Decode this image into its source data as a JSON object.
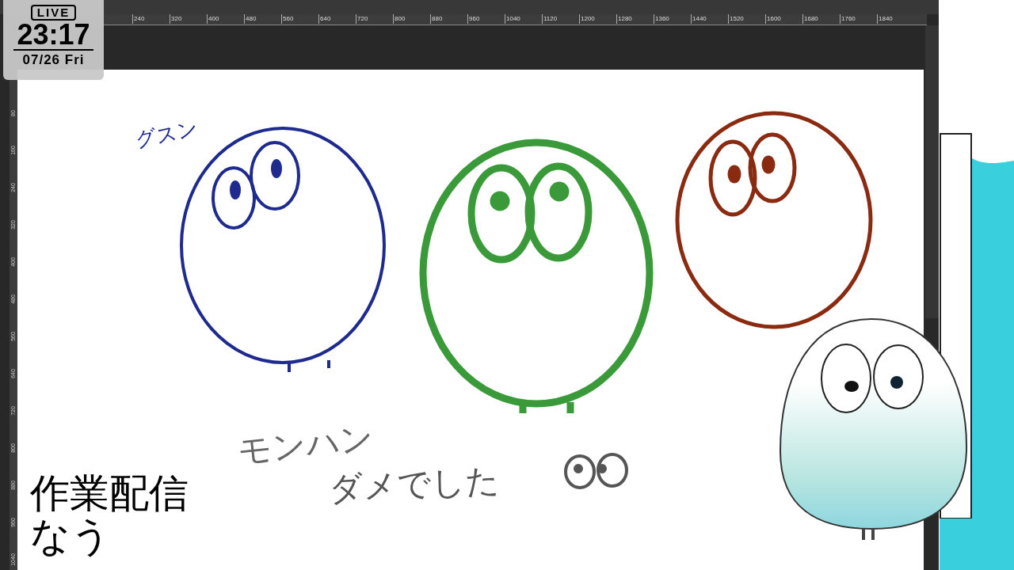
{
  "clock": {
    "badge": "LIVE",
    "time": "23:17",
    "date": "07/26 Fri"
  },
  "ruler_top": {
    "labels": [
      "240",
      "320",
      "400",
      "480",
      "560",
      "640",
      "720",
      "800",
      "880",
      "960",
      "1040",
      "1120",
      "1200",
      "1280",
      "1360",
      "1440",
      "1520",
      "1600",
      "1680",
      "1760",
      "1840"
    ]
  },
  "ruler_left": {
    "labels": [
      "80",
      "160",
      "240",
      "320",
      "400",
      "480",
      "560",
      "640",
      "720",
      "800",
      "880",
      "960",
      "1040"
    ]
  },
  "canvas": {
    "notes": [
      {
        "kind": "sob",
        "text": "グスン"
      },
      {
        "kind": "line1",
        "text": "モンハン"
      },
      {
        "kind": "line2",
        "text": "ダメでした"
      }
    ]
  },
  "caption": {
    "lines": [
      "作業配信",
      "なう"
    ]
  }
}
